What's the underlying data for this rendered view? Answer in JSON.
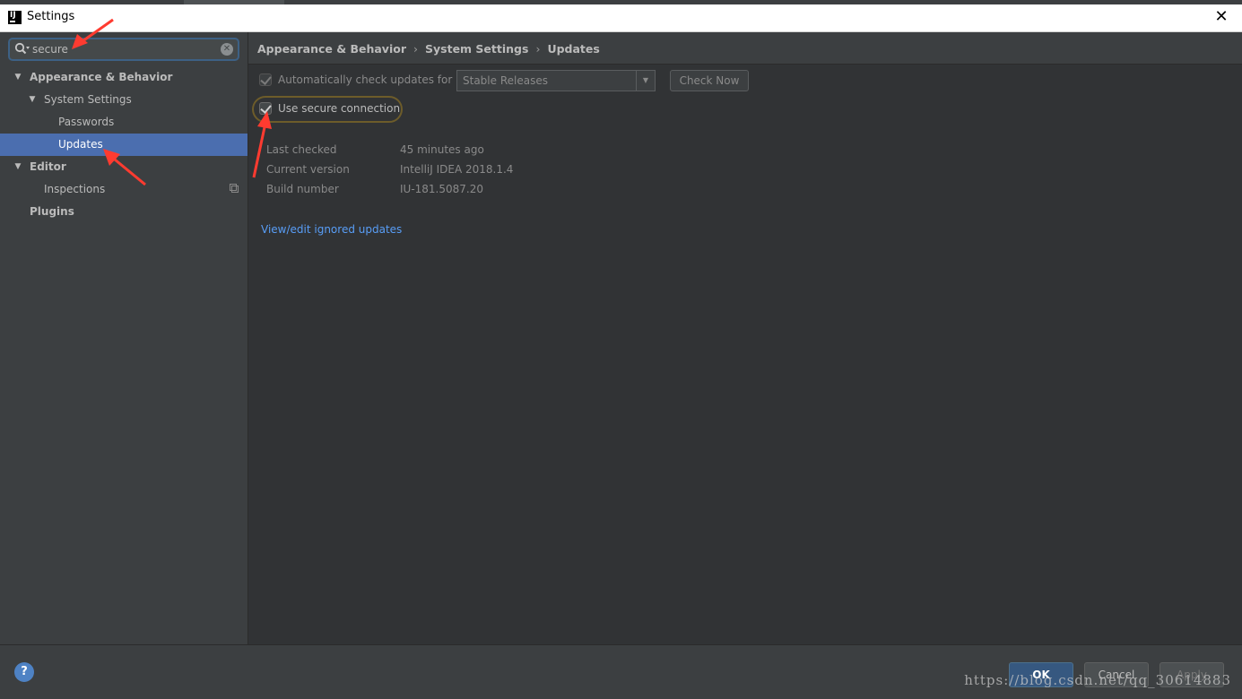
{
  "window": {
    "title": "Settings",
    "close_glyph": "✕"
  },
  "search": {
    "value": "secure"
  },
  "tree": {
    "items": [
      {
        "label": "Appearance & Behavior",
        "level": 0,
        "expanded": true
      },
      {
        "label": "System Settings",
        "level": 1,
        "expanded": true
      },
      {
        "label": "Passwords",
        "level": 2
      },
      {
        "label": "Updates",
        "level": 2,
        "selected": true
      },
      {
        "label": "Editor",
        "level": 0,
        "expanded": true
      },
      {
        "label": "Inspections",
        "level": 1
      },
      {
        "label": "Plugins",
        "level": 0
      }
    ]
  },
  "breadcrumb": {
    "items": [
      "Appearance & Behavior",
      "System Settings",
      "Updates"
    ],
    "separator": "›"
  },
  "updates": {
    "auto_check_label": "Automatically check updates for",
    "auto_check_checked": true,
    "channel_value": "Stable Releases",
    "check_now_label": "Check Now",
    "secure_label": "Use secure connection",
    "secure_checked": true,
    "info": [
      {
        "key": "Last checked",
        "value": "45 minutes ago"
      },
      {
        "key": "Current version",
        "value": "IntelliJ IDEA 2018.1.4"
      },
      {
        "key": "Build number",
        "value": "IU-181.5087.20"
      }
    ],
    "ignored_link": "View/edit ignored updates"
  },
  "footer": {
    "help_glyph": "?",
    "ok_label": "OK",
    "cancel_label": "Cancel",
    "apply_label": "Apply",
    "watermark": "https://blog.csdn.net/qq_30614883"
  },
  "colors": {
    "selection": "#4b6eaf",
    "link": "#589df6",
    "annotation": "#ff3b30",
    "highlight_ring": "#6d5c2a"
  }
}
